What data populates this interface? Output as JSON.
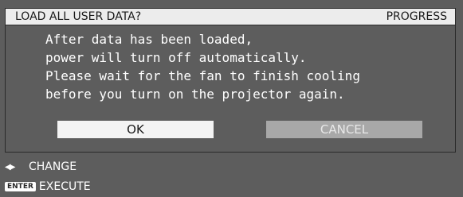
{
  "title_bar": {
    "title": "LOAD ALL USER DATA?",
    "section": "PROGRESS"
  },
  "message": {
    "lines": [
      "After data has been loaded,",
      "power will turn off automatically.",
      "Please wait for the fan to finish cooling",
      "before you turn on the projector again."
    ]
  },
  "buttons": {
    "ok_label": "OK",
    "cancel_label": "CANCEL"
  },
  "footer": {
    "change_icon": "left-right-arrows-icon",
    "change_label": "CHANGE",
    "enter_key_label": "ENTER",
    "execute_label": "EXECUTE"
  },
  "colors": {
    "background": "#5d5d5d",
    "title_bar": "#ececec",
    "ok_selected": "#f4f4f4",
    "cancel": "#a8a8a8"
  }
}
